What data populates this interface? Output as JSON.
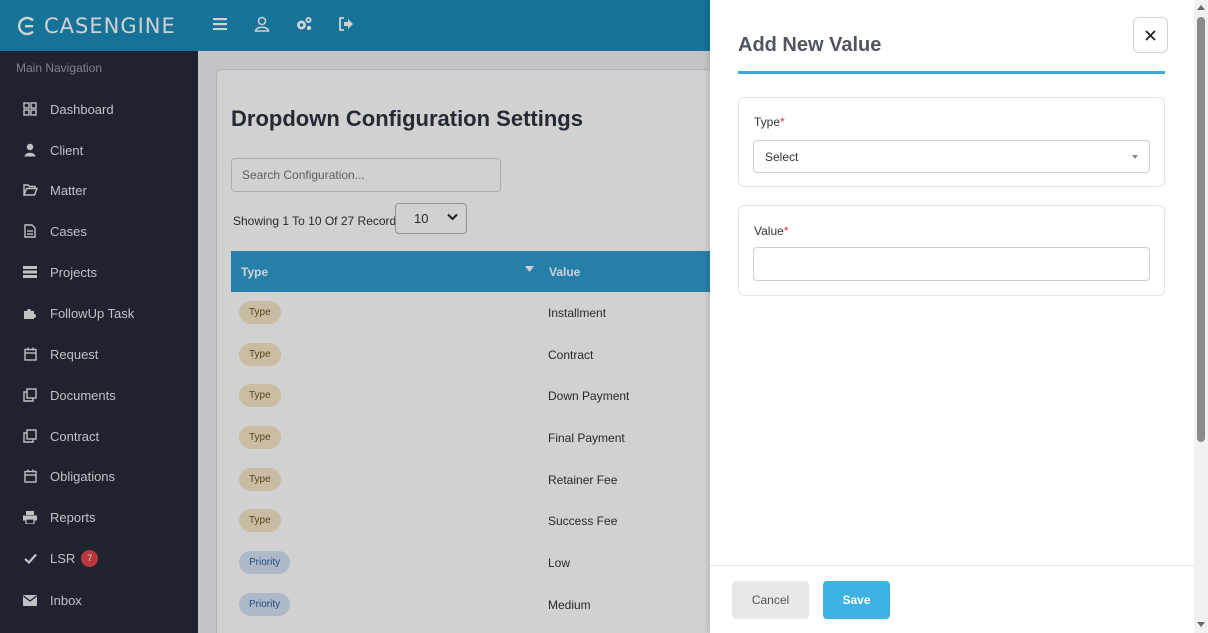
{
  "app": {
    "brand": "CASENGINE"
  },
  "topbar": {
    "icons": [
      "menu-icon",
      "user-icon",
      "settings-icon",
      "logout-icon"
    ]
  },
  "sidebar": {
    "heading": "Main Navigation",
    "items": [
      {
        "label": "Dashboard",
        "icon": "grid-icon"
      },
      {
        "label": "Client",
        "icon": "user-icon"
      },
      {
        "label": "Matter",
        "icon": "folder-open-icon"
      },
      {
        "label": "Cases",
        "icon": "file-icon"
      },
      {
        "label": "Projects",
        "icon": "server-icon"
      },
      {
        "label": "FollowUp Task",
        "icon": "puzzle-icon"
      },
      {
        "label": "Request",
        "icon": "calendar-icon"
      },
      {
        "label": "Documents",
        "icon": "copy-icon"
      },
      {
        "label": "Contract",
        "icon": "copy-icon"
      },
      {
        "label": "Obligations",
        "icon": "calendar-icon"
      },
      {
        "label": "Reports",
        "icon": "print-icon"
      },
      {
        "label": "LSR",
        "icon": "check-icon",
        "badge": "7"
      },
      {
        "label": "Inbox",
        "icon": "envelope-icon"
      }
    ]
  },
  "main": {
    "title": "Dropdown Configuration Settings",
    "search_placeholder": "Search Configuration...",
    "showing_text": "Showing 1 To 10 Of 27 Records",
    "per_page": "10",
    "columns": {
      "type": "Type",
      "value": "Value"
    },
    "rows": [
      {
        "type": "Type",
        "value": "Installment"
      },
      {
        "type": "Type",
        "value": "Contract"
      },
      {
        "type": "Type",
        "value": "Down Payment"
      },
      {
        "type": "Type",
        "value": "Final Payment"
      },
      {
        "type": "Type",
        "value": "Retainer Fee"
      },
      {
        "type": "Type",
        "value": "Success Fee"
      },
      {
        "type": "Priority",
        "value": "Low"
      },
      {
        "type": "Priority",
        "value": "Medium"
      }
    ]
  },
  "drawer": {
    "title": "Add New Value",
    "type_label": "Type",
    "type_select_value": "Select",
    "value_label": "Value",
    "value_input": "",
    "required_mark": "*",
    "cancel_label": "Cancel",
    "save_label": "Save"
  },
  "colors": {
    "topbar": "#1b8bb9",
    "sidebar": "#272b3a",
    "table_header": "#2f9bd0",
    "accent": "#3aa8d8",
    "save_button": "#3eb3e3",
    "badge": "#e0454a"
  }
}
